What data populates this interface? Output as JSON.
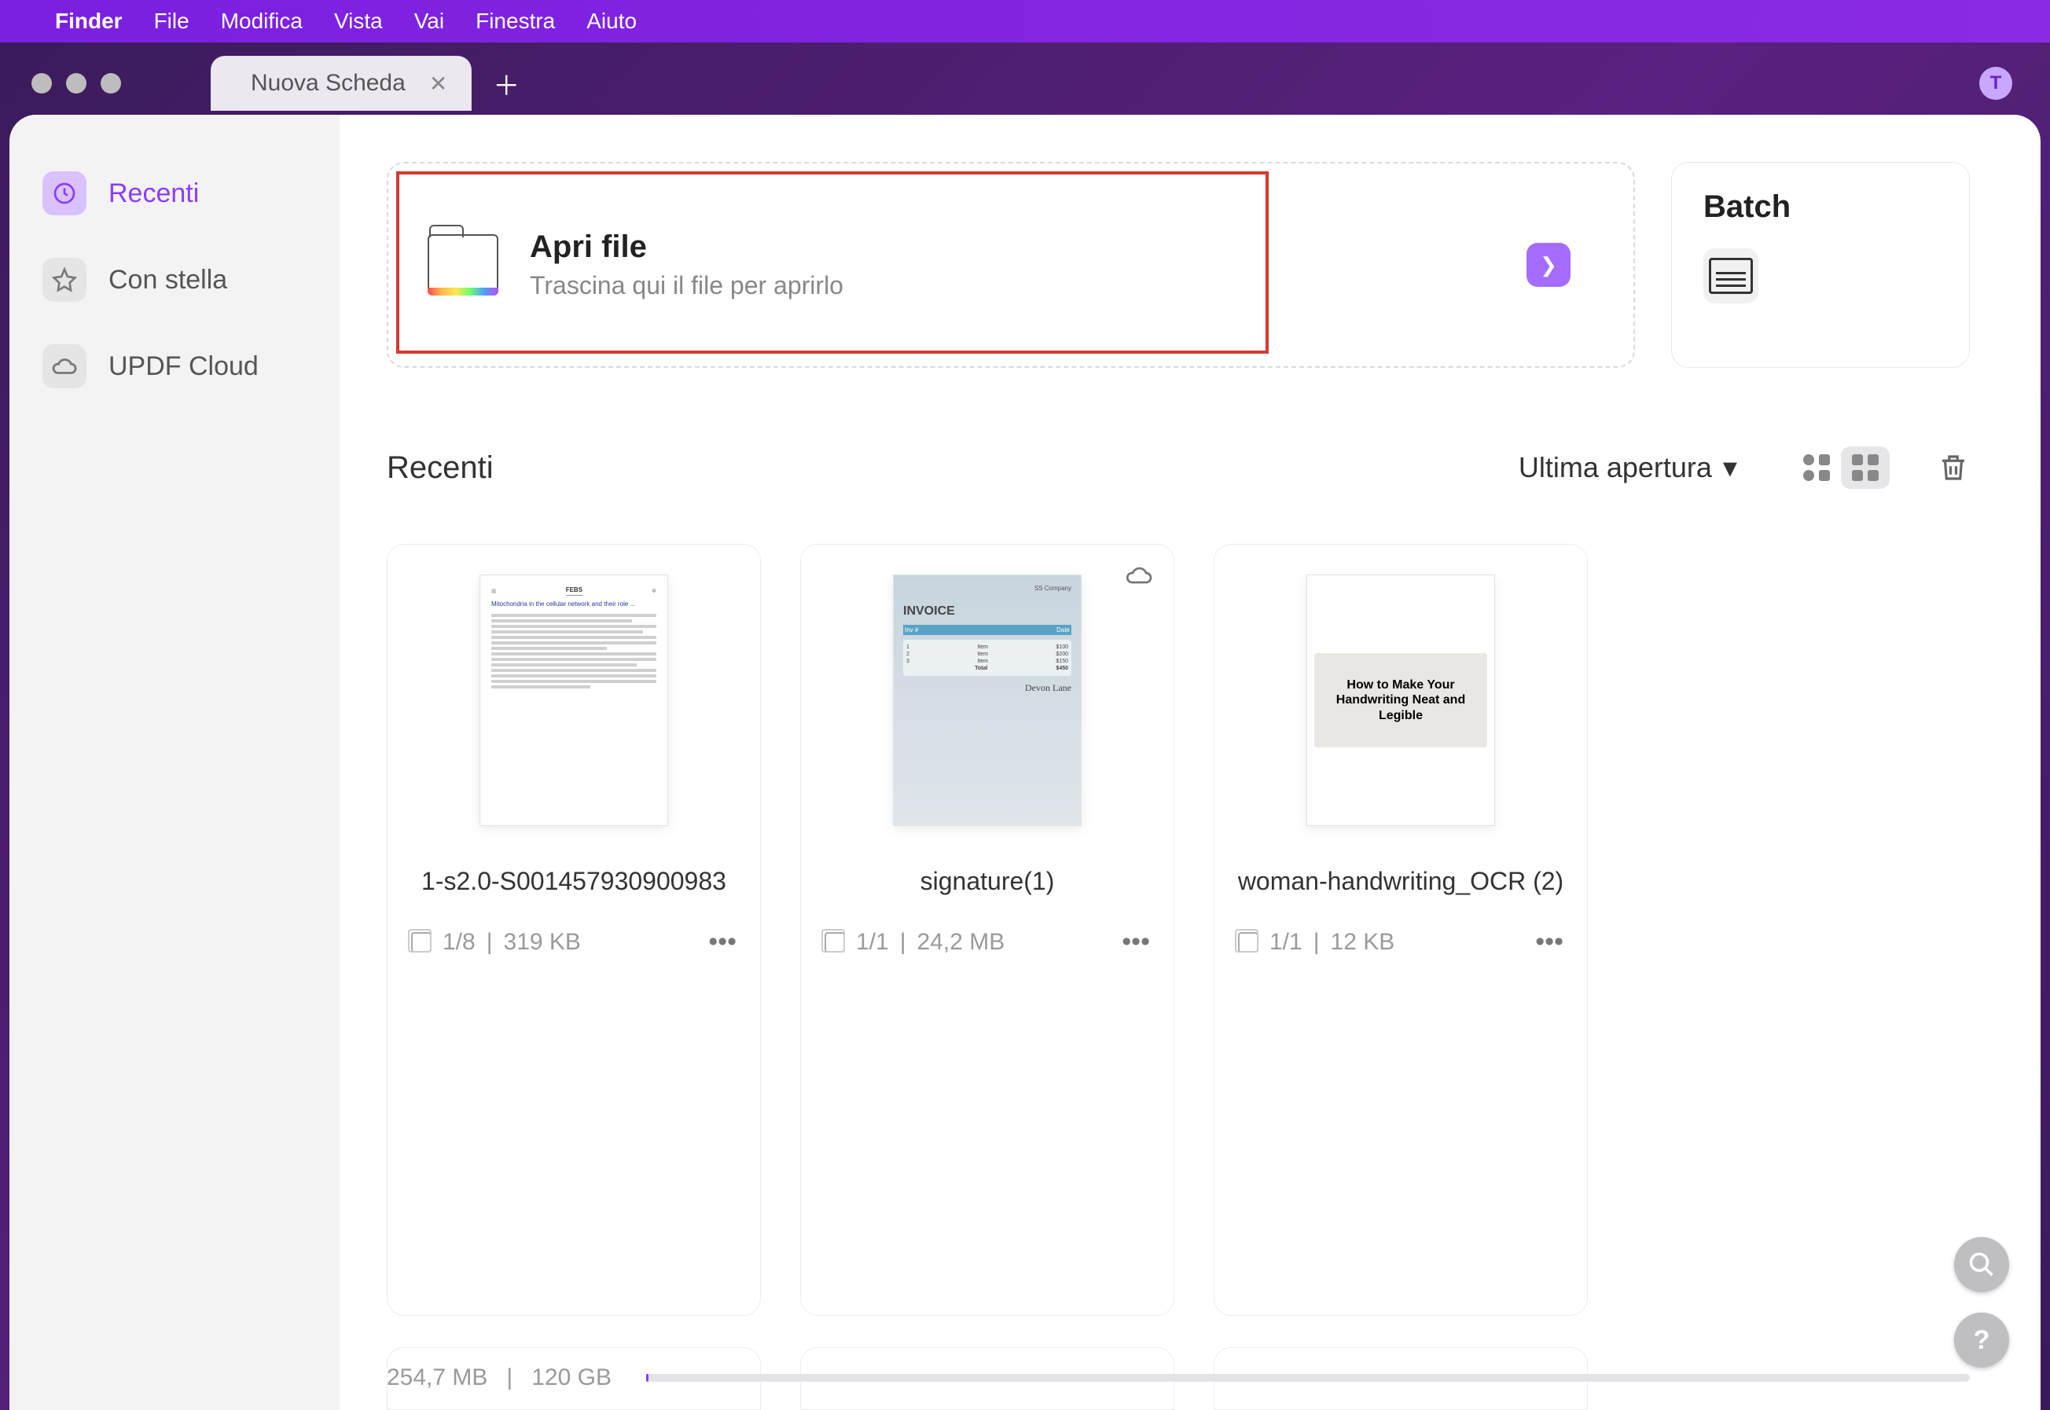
{
  "menubar": {
    "app": "Finder",
    "items": [
      "File",
      "Modifica",
      "Vista",
      "Vai",
      "Finestra",
      "Aiuto"
    ]
  },
  "window": {
    "tab_label": "Nuova Scheda",
    "avatar_letter": "T"
  },
  "sidebar": {
    "items": [
      {
        "label": "Recenti",
        "icon": "clock-icon",
        "active": true
      },
      {
        "label": "Con stella",
        "icon": "star-icon",
        "active": false
      },
      {
        "label": "UPDF Cloud",
        "icon": "cloud-icon",
        "active": false
      }
    ]
  },
  "open_file": {
    "title": "Apri file",
    "subtitle": "Trascina qui il file per aprirlo"
  },
  "batch": {
    "title": "Batch"
  },
  "recent_header": {
    "title": "Recenti",
    "sort_label": "Ultima apertura"
  },
  "files": [
    {
      "name": "1-s2.0-S001457930900983",
      "pages": "1/8",
      "size": "319 KB",
      "cloud": false,
      "thumb_type": "paper"
    },
    {
      "name": "signature(1)",
      "pages": "1/1",
      "size": "24,2 MB",
      "cloud": true,
      "thumb_type": "invoice"
    },
    {
      "name": "woman-handwriting_OCR (2)",
      "pages": "1/1",
      "size": "12 KB",
      "cloud": false,
      "thumb_type": "hand"
    }
  ],
  "thumb_text": {
    "paper_title": "FEBS",
    "invoice_company": "SS Company",
    "invoice_title": "INVOICE",
    "invoice_sig": "Devon Lane",
    "hand_text": "How to Make Your Handwriting Neat and Legible"
  },
  "storage": {
    "used": "254,7 MB",
    "total": "120 GB"
  },
  "help_glyph": "?"
}
